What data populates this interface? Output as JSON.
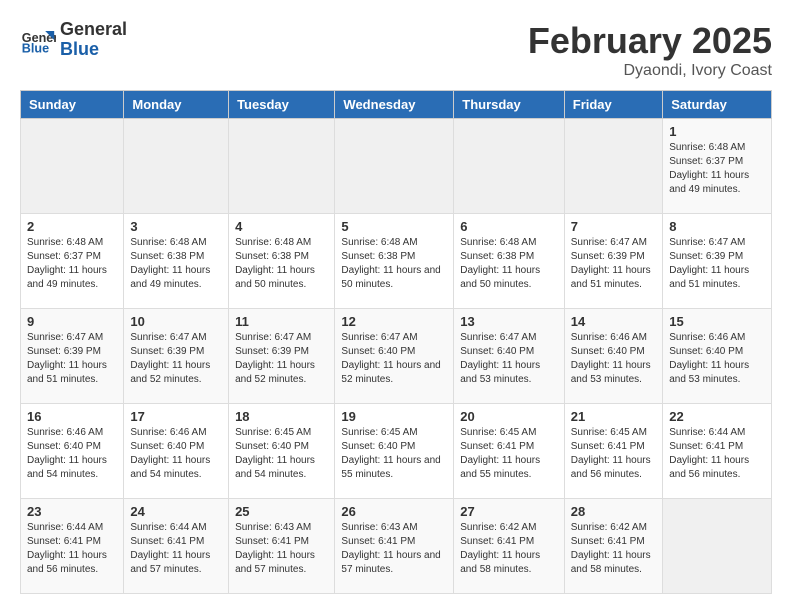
{
  "header": {
    "logo_general": "General",
    "logo_blue": "Blue",
    "month_title": "February 2025",
    "location": "Dyaondi, Ivory Coast"
  },
  "days_of_week": [
    "Sunday",
    "Monday",
    "Tuesday",
    "Wednesday",
    "Thursday",
    "Friday",
    "Saturday"
  ],
  "weeks": [
    [
      {
        "day": "",
        "info": ""
      },
      {
        "day": "",
        "info": ""
      },
      {
        "day": "",
        "info": ""
      },
      {
        "day": "",
        "info": ""
      },
      {
        "day": "",
        "info": ""
      },
      {
        "day": "",
        "info": ""
      },
      {
        "day": "1",
        "info": "Sunrise: 6:48 AM\nSunset: 6:37 PM\nDaylight: 11 hours and 49 minutes."
      }
    ],
    [
      {
        "day": "2",
        "info": "Sunrise: 6:48 AM\nSunset: 6:37 PM\nDaylight: 11 hours and 49 minutes."
      },
      {
        "day": "3",
        "info": "Sunrise: 6:48 AM\nSunset: 6:38 PM\nDaylight: 11 hours and 49 minutes."
      },
      {
        "day": "4",
        "info": "Sunrise: 6:48 AM\nSunset: 6:38 PM\nDaylight: 11 hours and 50 minutes."
      },
      {
        "day": "5",
        "info": "Sunrise: 6:48 AM\nSunset: 6:38 PM\nDaylight: 11 hours and 50 minutes."
      },
      {
        "day": "6",
        "info": "Sunrise: 6:48 AM\nSunset: 6:38 PM\nDaylight: 11 hours and 50 minutes."
      },
      {
        "day": "7",
        "info": "Sunrise: 6:47 AM\nSunset: 6:39 PM\nDaylight: 11 hours and 51 minutes."
      },
      {
        "day": "8",
        "info": "Sunrise: 6:47 AM\nSunset: 6:39 PM\nDaylight: 11 hours and 51 minutes."
      }
    ],
    [
      {
        "day": "9",
        "info": "Sunrise: 6:47 AM\nSunset: 6:39 PM\nDaylight: 11 hours and 51 minutes."
      },
      {
        "day": "10",
        "info": "Sunrise: 6:47 AM\nSunset: 6:39 PM\nDaylight: 11 hours and 52 minutes."
      },
      {
        "day": "11",
        "info": "Sunrise: 6:47 AM\nSunset: 6:39 PM\nDaylight: 11 hours and 52 minutes."
      },
      {
        "day": "12",
        "info": "Sunrise: 6:47 AM\nSunset: 6:40 PM\nDaylight: 11 hours and 52 minutes."
      },
      {
        "day": "13",
        "info": "Sunrise: 6:47 AM\nSunset: 6:40 PM\nDaylight: 11 hours and 53 minutes."
      },
      {
        "day": "14",
        "info": "Sunrise: 6:46 AM\nSunset: 6:40 PM\nDaylight: 11 hours and 53 minutes."
      },
      {
        "day": "15",
        "info": "Sunrise: 6:46 AM\nSunset: 6:40 PM\nDaylight: 11 hours and 53 minutes."
      }
    ],
    [
      {
        "day": "16",
        "info": "Sunrise: 6:46 AM\nSunset: 6:40 PM\nDaylight: 11 hours and 54 minutes."
      },
      {
        "day": "17",
        "info": "Sunrise: 6:46 AM\nSunset: 6:40 PM\nDaylight: 11 hours and 54 minutes."
      },
      {
        "day": "18",
        "info": "Sunrise: 6:45 AM\nSunset: 6:40 PM\nDaylight: 11 hours and 54 minutes."
      },
      {
        "day": "19",
        "info": "Sunrise: 6:45 AM\nSunset: 6:40 PM\nDaylight: 11 hours and 55 minutes."
      },
      {
        "day": "20",
        "info": "Sunrise: 6:45 AM\nSunset: 6:41 PM\nDaylight: 11 hours and 55 minutes."
      },
      {
        "day": "21",
        "info": "Sunrise: 6:45 AM\nSunset: 6:41 PM\nDaylight: 11 hours and 56 minutes."
      },
      {
        "day": "22",
        "info": "Sunrise: 6:44 AM\nSunset: 6:41 PM\nDaylight: 11 hours and 56 minutes."
      }
    ],
    [
      {
        "day": "23",
        "info": "Sunrise: 6:44 AM\nSunset: 6:41 PM\nDaylight: 11 hours and 56 minutes."
      },
      {
        "day": "24",
        "info": "Sunrise: 6:44 AM\nSunset: 6:41 PM\nDaylight: 11 hours and 57 minutes."
      },
      {
        "day": "25",
        "info": "Sunrise: 6:43 AM\nSunset: 6:41 PM\nDaylight: 11 hours and 57 minutes."
      },
      {
        "day": "26",
        "info": "Sunrise: 6:43 AM\nSunset: 6:41 PM\nDaylight: 11 hours and 57 minutes."
      },
      {
        "day": "27",
        "info": "Sunrise: 6:42 AM\nSunset: 6:41 PM\nDaylight: 11 hours and 58 minutes."
      },
      {
        "day": "28",
        "info": "Sunrise: 6:42 AM\nSunset: 6:41 PM\nDaylight: 11 hours and 58 minutes."
      },
      {
        "day": "",
        "info": ""
      }
    ]
  ]
}
